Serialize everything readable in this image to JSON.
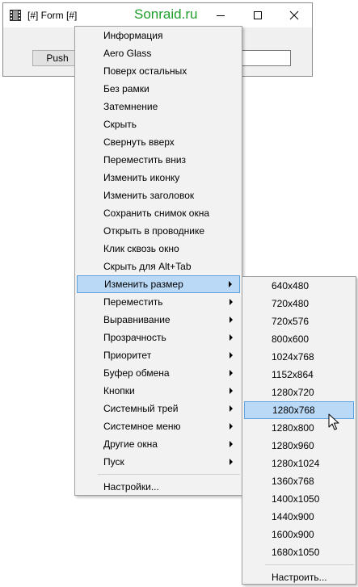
{
  "window": {
    "title": "[#] Form [#]",
    "watermark": "Sonraid.ru",
    "push_label": "Push",
    "icon": "film-strip-icon",
    "controls": [
      "minimize-icon",
      "maximize-icon",
      "close-icon"
    ]
  },
  "menu": {
    "items": [
      {
        "label": "Информация"
      },
      {
        "label": "Aero Glass"
      },
      {
        "label": "Поверх остальных"
      },
      {
        "label": "Без рамки"
      },
      {
        "label": "Затемнение"
      },
      {
        "label": "Скрыть"
      },
      {
        "label": "Свернуть вверх"
      },
      {
        "label": "Переместить вниз"
      },
      {
        "label": "Изменить иконку"
      },
      {
        "label": "Изменить заголовок"
      },
      {
        "label": "Сохранить снимок окна"
      },
      {
        "label": "Открыть в проводнике"
      },
      {
        "label": "Клик сквозь окно"
      },
      {
        "label": "Скрыть для Alt+Tab"
      },
      {
        "label": "Изменить размер",
        "submenu": true,
        "highlighted": true
      },
      {
        "label": "Переместить",
        "submenu": true
      },
      {
        "label": "Выравнивание",
        "submenu": true
      },
      {
        "label": "Прозрачность",
        "submenu": true
      },
      {
        "label": "Приоритет",
        "submenu": true
      },
      {
        "label": "Буфер обмена",
        "submenu": true
      },
      {
        "label": "Кнопки",
        "submenu": true
      },
      {
        "label": "Системный трей",
        "submenu": true
      },
      {
        "label": "Системное меню",
        "submenu": true
      },
      {
        "label": "Другие окна",
        "submenu": true
      },
      {
        "label": "Пуск",
        "submenu": true
      }
    ],
    "footer": "Настройки..."
  },
  "submenu": {
    "items": [
      {
        "label": "640x480"
      },
      {
        "label": "720x480"
      },
      {
        "label": "720x576"
      },
      {
        "label": "800x600"
      },
      {
        "label": "1024x768"
      },
      {
        "label": "1152x864"
      },
      {
        "label": "1280x720"
      },
      {
        "label": "1280x768",
        "highlighted": true
      },
      {
        "label": "1280x800"
      },
      {
        "label": "1280x960"
      },
      {
        "label": "1280x1024"
      },
      {
        "label": "1360x768"
      },
      {
        "label": "1400x1050"
      },
      {
        "label": "1440x900"
      },
      {
        "label": "1600x900"
      },
      {
        "label": "1680x1050"
      }
    ],
    "footer": "Настроить..."
  },
  "colors": {
    "highlight_bg": "#b9d9f6",
    "highlight_border": "#5fa0dd",
    "watermark": "#1f9e2c",
    "menu_bg": "#f2f2f2"
  }
}
